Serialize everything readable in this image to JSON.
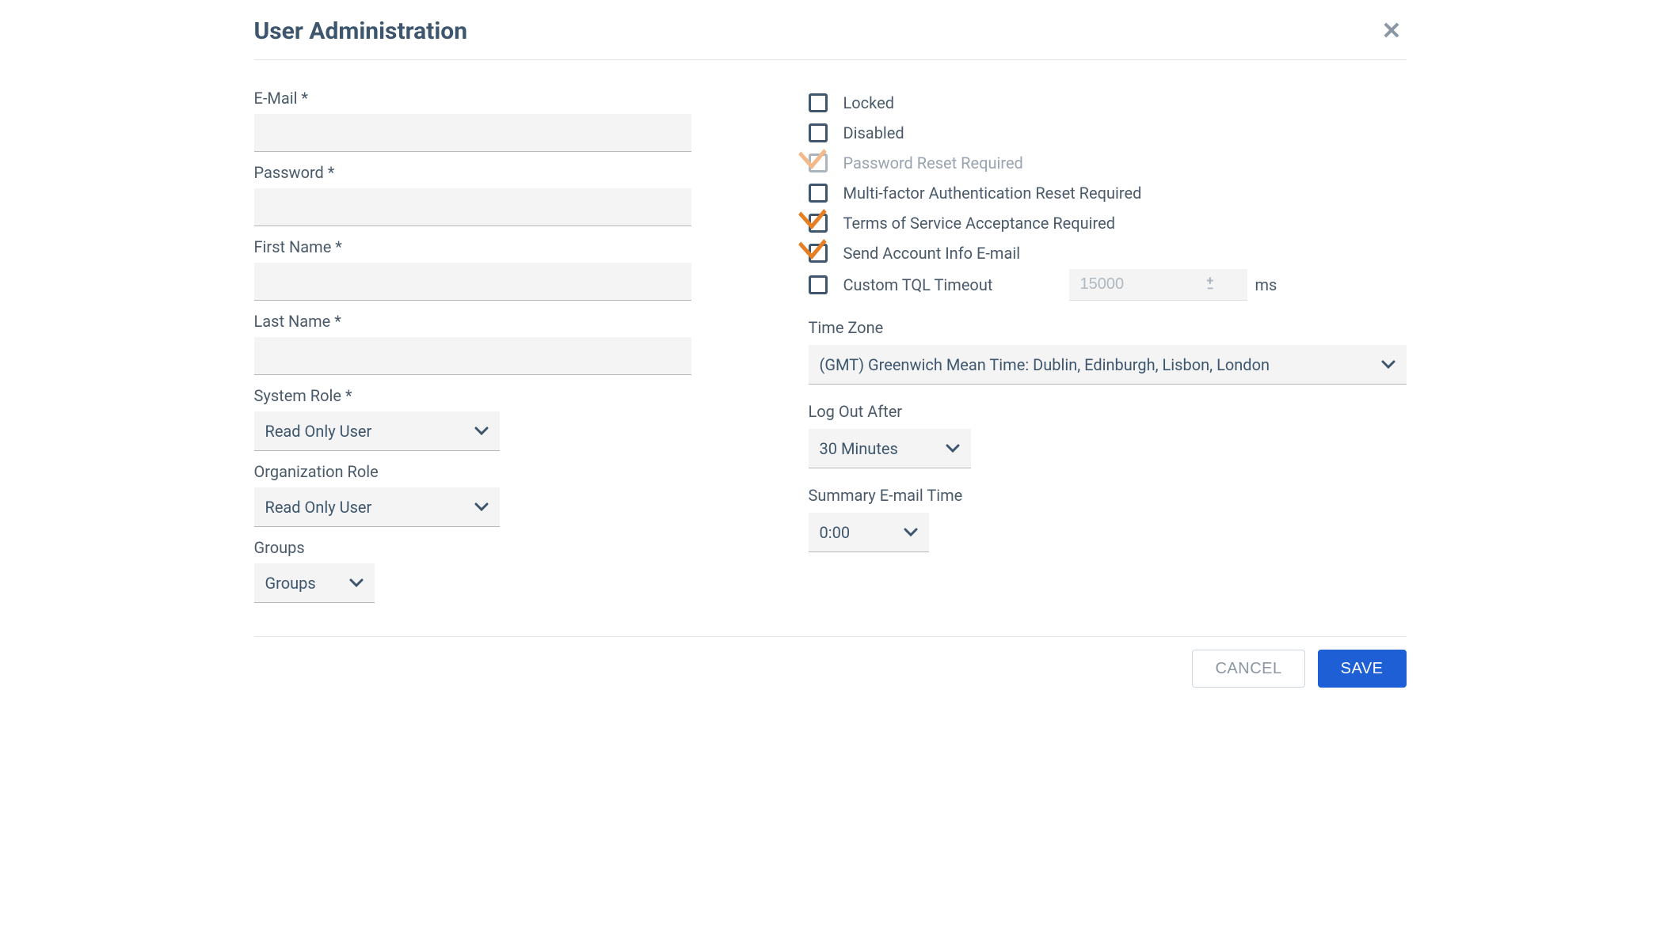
{
  "header": {
    "title": "User Administration"
  },
  "left": {
    "email_label": "E-Mail *",
    "email_value": "",
    "password_label": "Password *",
    "password_value": "",
    "first_name_label": "First Name *",
    "first_name_value": "",
    "last_name_label": "Last Name *",
    "last_name_value": "",
    "system_role_label": "System Role *",
    "system_role_value": "Read Only User",
    "org_role_label": "Organization Role",
    "org_role_value": "Read Only User",
    "groups_label": "Groups",
    "groups_value": "Groups"
  },
  "right": {
    "checkboxes": {
      "locked": {
        "label": "Locked",
        "checked": false,
        "disabled": false
      },
      "disabled": {
        "label": "Disabled",
        "checked": false,
        "disabled": false
      },
      "password_reset": {
        "label": "Password Reset Required",
        "checked": true,
        "disabled": true
      },
      "mfa_reset": {
        "label": "Multi-factor Authentication Reset Required",
        "checked": false,
        "disabled": false
      },
      "tos": {
        "label": "Terms of Service Acceptance Required",
        "checked": true,
        "disabled": false
      },
      "send_email": {
        "label": "Send Account Info E-mail",
        "checked": true,
        "disabled": false
      },
      "tql": {
        "label": "Custom TQL Timeout",
        "checked": false,
        "disabled": false
      }
    },
    "tql_placeholder": "15000",
    "tql_unit": "ms",
    "timezone_label": "Time Zone",
    "timezone_value": "(GMT) Greenwich Mean Time: Dublin, Edinburgh, Lisbon, London",
    "logout_label": "Log Out After",
    "logout_value": "30 Minutes",
    "summary_label": "Summary E-mail Time",
    "summary_value": "0:00"
  },
  "footer": {
    "cancel": "CANCEL",
    "save": "SAVE"
  }
}
